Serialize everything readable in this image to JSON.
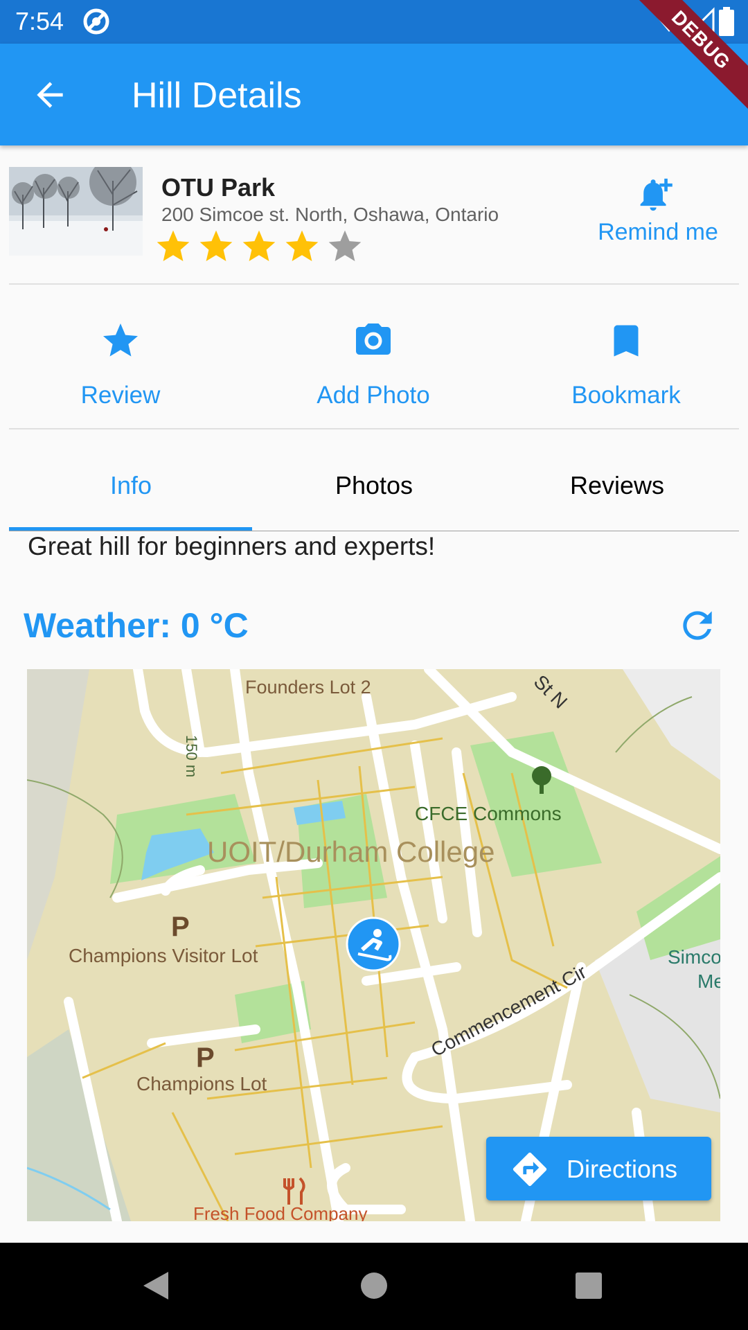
{
  "status_bar": {
    "time": "7:54"
  },
  "app_bar": {
    "title": "Hill Details",
    "debug_banner": "DEBUG"
  },
  "hill": {
    "name": "OTU Park",
    "address": "200 Simcoe st. North, Oshawa, Ontario",
    "rating": 4,
    "rating_max": 5
  },
  "remind": {
    "label": "Remind me",
    "icon": "bell-plus-icon"
  },
  "actions": [
    {
      "label": "Review",
      "icon": "star-icon"
    },
    {
      "label": "Add Photo",
      "icon": "camera-icon"
    },
    {
      "label": "Bookmark",
      "icon": "bookmark-icon"
    }
  ],
  "tabs": [
    {
      "label": "Info",
      "active": true
    },
    {
      "label": "Photos",
      "active": false
    },
    {
      "label": "Reviews",
      "active": false
    }
  ],
  "info": {
    "description": "Great hill for beginners and experts!",
    "weather": "Weather: 0 °C"
  },
  "map": {
    "labels": {
      "founders": "Founders Lot 2",
      "campus": "UOIT/Durham College",
      "cfce": "CFCE Commons",
      "visitor_lot": "Champions Visitor Lot",
      "champions_lot": "Champions Lot",
      "commencement": "Commencement Cir",
      "fresh_food": "Fresh Food Company",
      "road_150": "150 m",
      "street": "St N",
      "simcoe": "Simco",
      "me": "Me",
      "parking": "P"
    },
    "directions_label": "Directions"
  },
  "colors": {
    "primary": "#2196f3",
    "status_bar": "#1976d2",
    "star_filled": "#ffc107",
    "star_empty": "#9e9e9e",
    "map_land": "#e6dfb8",
    "map_green": "#b3e19a",
    "map_water": "#7fcdf0"
  }
}
